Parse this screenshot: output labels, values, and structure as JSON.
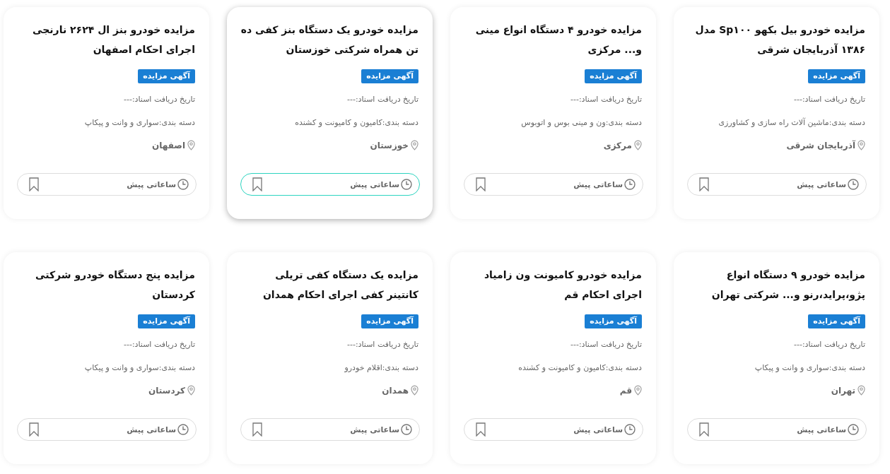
{
  "cards": [
    {
      "title": "مزایده خودرو بیل بکهو Sp۱۰۰ مدل ۱۳۸۶ آذربایجان شرقی",
      "badge": "آگهی مزایده",
      "date": "تاریخ دریافت اسناد:---",
      "category": "دسته بندی:ماشین آلات راه سازی و کشاورزی",
      "location": "آذربایجان شرقی",
      "time": "ساعاتی پیش",
      "hovered": false
    },
    {
      "title": "مزایده خودرو ۴ دستگاه انواع مینی و... مرکزی",
      "badge": "آگهی مزایده",
      "date": "تاریخ دریافت اسناد:---",
      "category": "دسته بندی:ون و مینی بوس و اتوبوس",
      "location": "مرکزی",
      "time": "ساعاتی پیش",
      "hovered": false
    },
    {
      "title": "مزایده خودرو یک دستگاه بنز کفی ده تن همراه شرکتی خوزستان",
      "badge": "آگهی مزایده",
      "date": "تاریخ دریافت اسناد:---",
      "category": "دسته بندی:کامیون و کامیونت و کشنده",
      "location": "خوزستان",
      "time": "ساعاتی پیش",
      "hovered": true
    },
    {
      "title": "مزایده خودرو بنز ال ۲۶۲۴ نارنجی اجرای احکام اصفهان",
      "badge": "آگهی مزایده",
      "date": "تاریخ دریافت اسناد:---",
      "category": "دسته بندی:سواری و وانت و پیکاپ",
      "location": "اصفهان",
      "time": "ساعاتی پیش",
      "hovered": false
    },
    {
      "title": "مزایده خودرو ۹ دستگاه انواع پژو،پراید،رنو و... شرکتی تهران",
      "badge": "آگهی مزایده",
      "date": "تاریخ دریافت اسناد:---",
      "category": "دسته بندی:سواری و وانت و پیکاپ",
      "location": "تهران",
      "time": "ساعاتی پیش",
      "hovered": false
    },
    {
      "title": "مزایده خودرو کامیونت ون زامیاد اجرای احکام قم",
      "badge": "آگهی مزایده",
      "date": "تاریخ دریافت اسناد:---",
      "category": "دسته بندی:کامیون و کامیونت و کشنده",
      "location": "قم",
      "time": "ساعاتی پیش",
      "hovered": false
    },
    {
      "title": "مزایده یک دستگاه کفی تریلی کانتینر کفی اجرای احکام همدان",
      "badge": "آگهی مزایده",
      "date": "تاریخ دریافت اسناد:---",
      "category": "دسته بندی:اقلام خودرو",
      "location": "همدان",
      "time": "ساعاتی پیش",
      "hovered": false
    },
    {
      "title": "مزایده پنج دستگاه خودرو شرکتی کردستان",
      "badge": "آگهی مزایده",
      "date": "تاریخ دریافت اسناد:---",
      "category": "دسته بندی:سواری و وانت و پیکاپ",
      "location": "کردستان",
      "time": "ساعاتی پیش",
      "hovered": false
    }
  ]
}
